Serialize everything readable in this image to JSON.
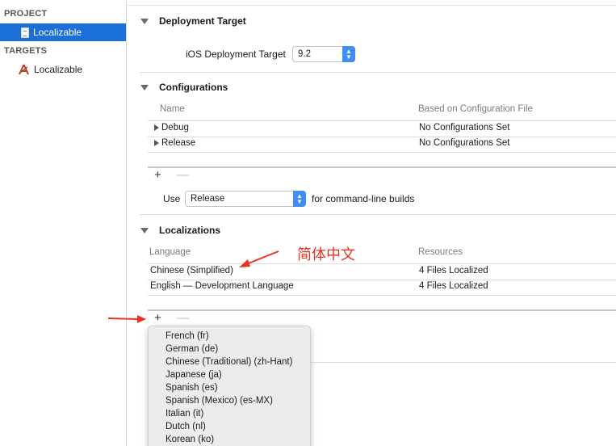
{
  "sidebar": {
    "project_header": "PROJECT",
    "project_item": "Localizable",
    "targets_header": "TARGETS",
    "target_item": "Localizable",
    "selected_color": "#1a6fd9"
  },
  "deployment": {
    "title": "Deployment Target",
    "label": "iOS Deployment Target",
    "value": "9.2"
  },
  "configurations": {
    "title": "Configurations",
    "col_name": "Name",
    "col_file": "Based on Configuration File",
    "rows": [
      {
        "name": "Debug",
        "file": "No Configurations Set"
      },
      {
        "name": "Release",
        "file": "No Configurations Set"
      }
    ],
    "add": "+",
    "remove": "—",
    "use_label": "Use",
    "use_value": "Release",
    "use_suffix": "for command-line builds"
  },
  "localizations": {
    "title": "Localizations",
    "col_language": "Language",
    "col_resources": "Resources",
    "rows": [
      {
        "language": "Chinese (Simplified)",
        "resources": "4 Files Localized"
      },
      {
        "language": "English — Development Language",
        "resources": "4 Files Localized"
      }
    ],
    "add": "+",
    "remove": "—"
  },
  "annotation": {
    "text": "简体中文",
    "color": "#e8321e"
  },
  "language_menu": [
    "French (fr)",
    "German (de)",
    "Chinese (Traditional) (zh-Hant)",
    "Japanese (ja)",
    "Spanish (es)",
    "Spanish (Mexico) (es-MX)",
    "Italian (it)",
    "Dutch (nl)",
    "Korean (ko)"
  ],
  "accent_color": "#3d8ef5"
}
